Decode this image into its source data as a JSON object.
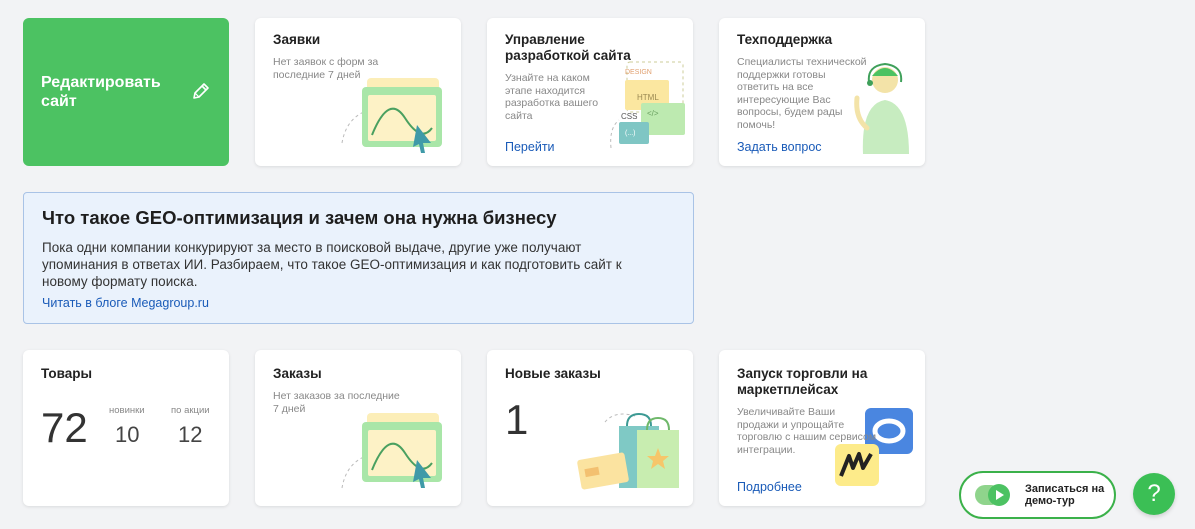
{
  "edit_site": {
    "label": "Редактировать сайт"
  },
  "cards": {
    "requests": {
      "title": "Заявки",
      "desc": "Нет заявок с форм за последние 7 дней"
    },
    "dev": {
      "title": "Управление разработкой сайта",
      "desc": "Узнайте на каком этапе находится разработка вашего сайта",
      "link": "Перейти",
      "tags": [
        "DESIGN",
        "HTML",
        "CSS",
        "(...)",
        "</>"
      ]
    },
    "support": {
      "title": "Техподдержка",
      "desc": "Специалисты технической поддержки готовы ответить на все интересующие Вас вопросы, будем рады помочь!",
      "link": "Задать вопрос"
    },
    "products": {
      "title": "Товары",
      "total": "72",
      "new_label": "новинки",
      "new_value": "10",
      "promo_label": "по акции",
      "promo_value": "12"
    },
    "orders": {
      "title": "Заказы",
      "desc": "Нет заказов за последние 7 дней"
    },
    "new_orders": {
      "title": "Новые заказы",
      "value": "1"
    },
    "marketplace": {
      "title": "Запуск торговли на маркетплейсах",
      "desc": "Увеличивайте Ваши продажи и упрощайте торговлю с нашим сервисом интеграции.",
      "link": "Подробнее"
    }
  },
  "blog": {
    "title": "Что такое GEO-оптимизация и зачем она нужна бизнесу",
    "text": "Пока одни компании конкурируют за место в поисковой выдаче, другие уже получают упоминания в ответах ИИ. Разбираем, что такое GEO-оптимизация и как подготовить сайт к новому формату поиска.",
    "link": "Читать в блоге Megagroup.ru"
  },
  "demo": {
    "label": "Записаться на демо-тур"
  },
  "help": {
    "glyph": "?"
  },
  "colors": {
    "green": "#4cc262",
    "link": "#1a5bb8",
    "blog_bg": "#eaf2fc"
  }
}
